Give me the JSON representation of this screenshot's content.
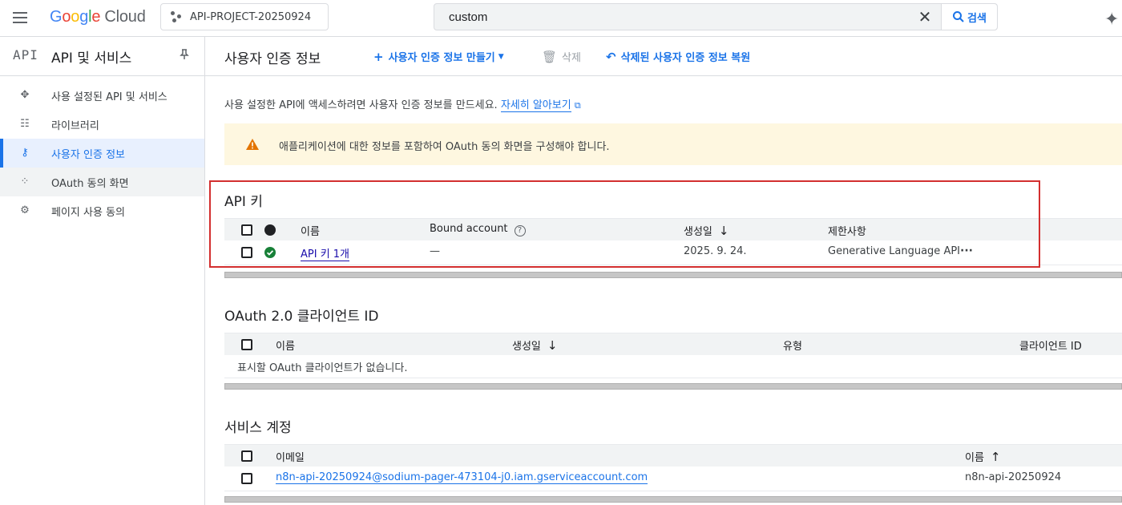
{
  "topbar": {
    "logo_google": [
      "G",
      "o",
      "o",
      "g",
      "l",
      "e"
    ],
    "logo_cloud": "Cloud",
    "project_name": "API-PROJECT-20250924",
    "search_value": "custom",
    "search_button": "검색"
  },
  "sidebar": {
    "api_logo": "API",
    "title": "API 및 서비스",
    "items": [
      {
        "label": "사용 설정된 API 및 서비스",
        "icon": "services-icon",
        "glyph": "✥"
      },
      {
        "label": "라이브러리",
        "icon": "library-icon",
        "glyph": "☷"
      },
      {
        "label": "사용자 인증 정보",
        "icon": "key-icon",
        "glyph": "⚷"
      },
      {
        "label": "OAuth 동의 화면",
        "icon": "oauth-icon",
        "glyph": "⁘"
      },
      {
        "label": "페이지 사용 동의",
        "icon": "settings-list-icon",
        "glyph": "⚙"
      }
    ]
  },
  "main": {
    "title": "사용자 인증 정보",
    "create_label": "사용자 인증 정보 만들기",
    "delete_label": "삭제",
    "restore_label": "삭제된 사용자 인증 정보 복원",
    "description": "사용 설정한 API에 액세스하려면 사용자 인증 정보를 만드세요.",
    "learn_more": "자세히 알아보기",
    "banner_text": "애플리케이션에 대한 정보를 포함하여 OAuth 동의 화면을 구성해야 합니다."
  },
  "api_keys": {
    "title": "API 키",
    "headers": {
      "name": "이름",
      "bound": "Bound account",
      "created": "생성일",
      "restrictions": "제한사항"
    },
    "rows": [
      {
        "name": "API 키 1개",
        "bound": "—",
        "created": "2025. 9. 24.",
        "restrictions": "Generative Language API"
      }
    ]
  },
  "oauth": {
    "title": "OAuth 2.0 클라이언트 ID",
    "headers": {
      "name": "이름",
      "created": "생성일",
      "type": "유형",
      "client_id": "클라이언트 ID"
    },
    "empty_text": "표시할 OAuth 클라이언트가 없습니다."
  },
  "service_accounts": {
    "title": "서비스 계정",
    "headers": {
      "email": "이메일",
      "name": "이름"
    },
    "rows": [
      {
        "email": "n8n-api-20250924@sodium-pager-473104-j0.iam.gserviceaccount.com",
        "name": "n8n-api-20250924"
      }
    ]
  },
  "colors": {
    "accent": "#1a73e8",
    "warning_bg": "#fef7e0",
    "warning_icon": "#e37400",
    "success": "#188038",
    "highlight": "#d32f2f"
  }
}
